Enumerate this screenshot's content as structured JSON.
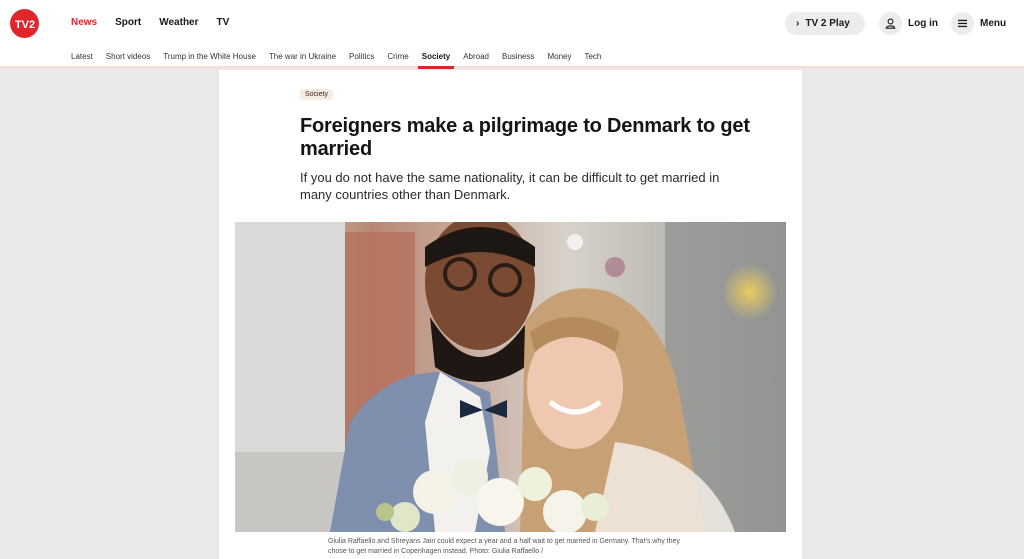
{
  "header": {
    "logo_text": "TV2",
    "nav": [
      "News",
      "Sport",
      "Weather",
      "TV"
    ],
    "nav_active": "News",
    "tv2play_label": "TV 2 Play",
    "login_label": "Log in",
    "menu_label": "Menu",
    "subnav": [
      "Latest",
      "Short videos",
      "Trump in the White House",
      "The war in Ukraine",
      "Politics",
      "Crime",
      "Society",
      "Abroad",
      "Business",
      "Money",
      "Tech"
    ],
    "subnav_active": "Society"
  },
  "article": {
    "tag": "Society",
    "headline": "Foreigners make a pilgrimage to Denmark to get married",
    "lead": "If you do not have the same nationality, it can be difficult to get married in many countries other than Denmark.",
    "caption": "Giulia Raffaello and Shreyans Jain could expect a year and a half wait to get married in Germany. That's why they chose to get married in Copenhagen instead. Photo: Giulia Raffaello /"
  },
  "colors": {
    "brand_red": "#e0262b",
    "page_bg": "#e9e9ec",
    "tag_bg": "#f5ebe2"
  },
  "icons": [
    "tv2-logo-icon",
    "chevron-right-icon",
    "user-icon",
    "hamburger-menu-icon"
  ]
}
